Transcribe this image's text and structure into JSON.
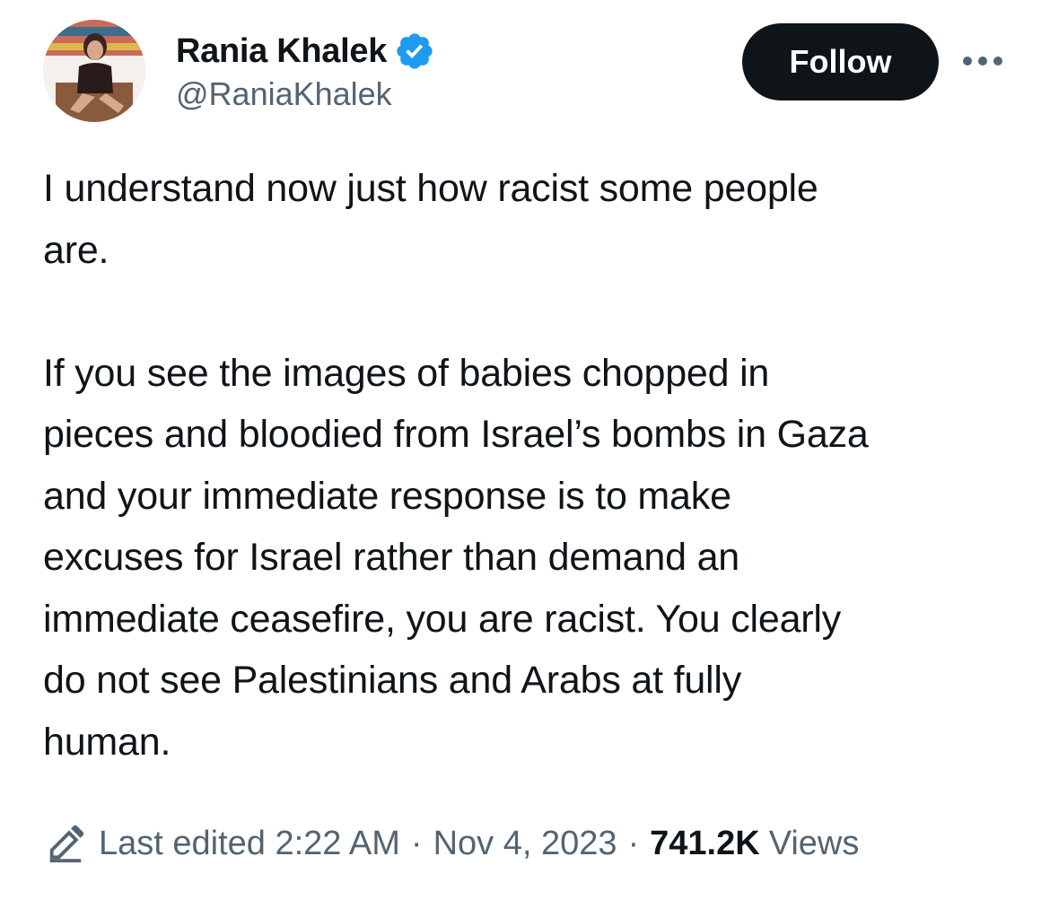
{
  "author": {
    "display_name": "Rania Khalek",
    "handle": "@RaniaKhalek",
    "verified_icon": "verified-badge-icon",
    "avatar_icon": "profile-photo"
  },
  "actions": {
    "follow_label": "Follow",
    "more_icon": "more-horizontal-icon"
  },
  "tweet": {
    "text": "I understand now just how racist some people\nare.\n\nIf you see the images of babies chopped in\npieces and bloodied from Israel’s bombs in Gaza\nand your immediate response is to make\nexcuses for Israel rather than demand an\nimmediate ceasefire, you are racist. You clearly\ndo not see Palestinians and Arabs at fully\nhuman."
  },
  "meta": {
    "edit_icon": "pencil-edit-icon",
    "edited_label": "Last edited 2:22 AM",
    "separator": "·",
    "date": "Nov 4, 2023",
    "views_count": "741.2K",
    "views_label": "Views"
  },
  "colors": {
    "text_primary": "#0f1419",
    "text_secondary": "#536471",
    "verified_blue": "#1d9bf0",
    "follow_bg": "#0f1419",
    "follow_text": "#ffffff"
  }
}
